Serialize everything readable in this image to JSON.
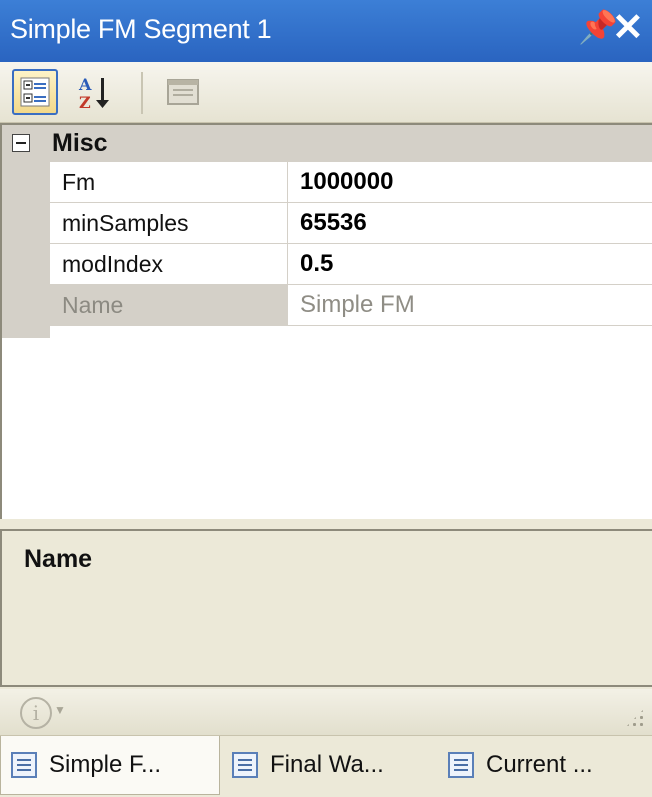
{
  "window": {
    "title": "Simple FM Segment 1",
    "pin_glyph": "չ",
    "close_glyph": "✕"
  },
  "toolbar": {
    "buttons": [
      {
        "icon": "categorized-icon",
        "active": true
      },
      {
        "icon": "sort-alphabetical-icon",
        "active": false
      },
      {
        "icon": "property-pages-icon",
        "active": false
      }
    ]
  },
  "grid": {
    "category": {
      "label": "Misc",
      "expanded": true
    },
    "properties": [
      {
        "name": "Fm",
        "value": "1000000",
        "readonly": false
      },
      {
        "name": "minSamples",
        "value": "65536",
        "readonly": false
      },
      {
        "name": "modIndex",
        "value": "0.5",
        "readonly": false
      },
      {
        "name": "Name",
        "value": "Simple FM",
        "readonly": true
      }
    ]
  },
  "description": {
    "title": "Name"
  },
  "tabs": [
    {
      "label": "Simple F...",
      "active": true
    },
    {
      "label": "Final Wa...",
      "active": false
    },
    {
      "label": "Current ...",
      "active": false
    }
  ],
  "colors": {
    "titlebar": "#2a64c0",
    "panel": "#ece9d8",
    "grid_margin": "#d4d0c8"
  }
}
